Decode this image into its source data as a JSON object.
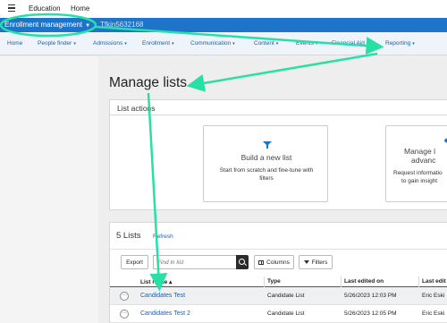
{
  "topbar": {
    "breadcrumb_1": "Education",
    "breadcrumb_2": "Home"
  },
  "env": {
    "label": "Enrollment management",
    "id": "Tfkin5632168"
  },
  "nav": {
    "items": [
      {
        "label": "Home",
        "caret": ""
      },
      {
        "label": "People finder",
        "caret": "▾"
      },
      {
        "label": "Admissions",
        "caret": "▾"
      },
      {
        "label": "Enrollment",
        "caret": "▾"
      },
      {
        "label": "Communication",
        "caret": "▾"
      },
      {
        "label": "Content",
        "caret": "▾"
      },
      {
        "label": "Events",
        "caret": "▾"
      },
      {
        "label": "Financial Aid",
        "caret": ""
      },
      {
        "label": "Reporting",
        "caret": "▾"
      }
    ]
  },
  "page": {
    "title": "Manage lists"
  },
  "list_actions": {
    "header": "List actions",
    "build": {
      "title": "Build a new list",
      "description": "Start from scratch and fine-tune with filters"
    },
    "manage": {
      "title_line1": "Manage l",
      "title_line2": "advanc",
      "desc_line1": "Request informatio",
      "desc_line2": "to gain insight"
    }
  },
  "lists": {
    "title": "5 Lists",
    "refresh_label": "Refresh",
    "export_label": "Export",
    "search_placeholder": "Find in list",
    "columns_label": "Columns",
    "filters_label": "Filters",
    "headers": {
      "name": "List name ▴",
      "type": "Type",
      "last_edited_on": "Last edited on",
      "last_edited_by": "Last edit"
    },
    "rows": [
      {
        "name": "Candidates Test",
        "type": "Candidate List",
        "edited_on": "5/26/2023 12:03 PM",
        "edited_by": "Eric Eski"
      },
      {
        "name": "Candidates Test 2",
        "type": "Candidate List",
        "edited_on": "5/26/2023 12:05 PM",
        "edited_by": "Eric Eski"
      }
    ]
  },
  "colors": {
    "env_bar": "#1d74c9",
    "annotation": "#28e0a6",
    "link": "#1f5fa8"
  }
}
